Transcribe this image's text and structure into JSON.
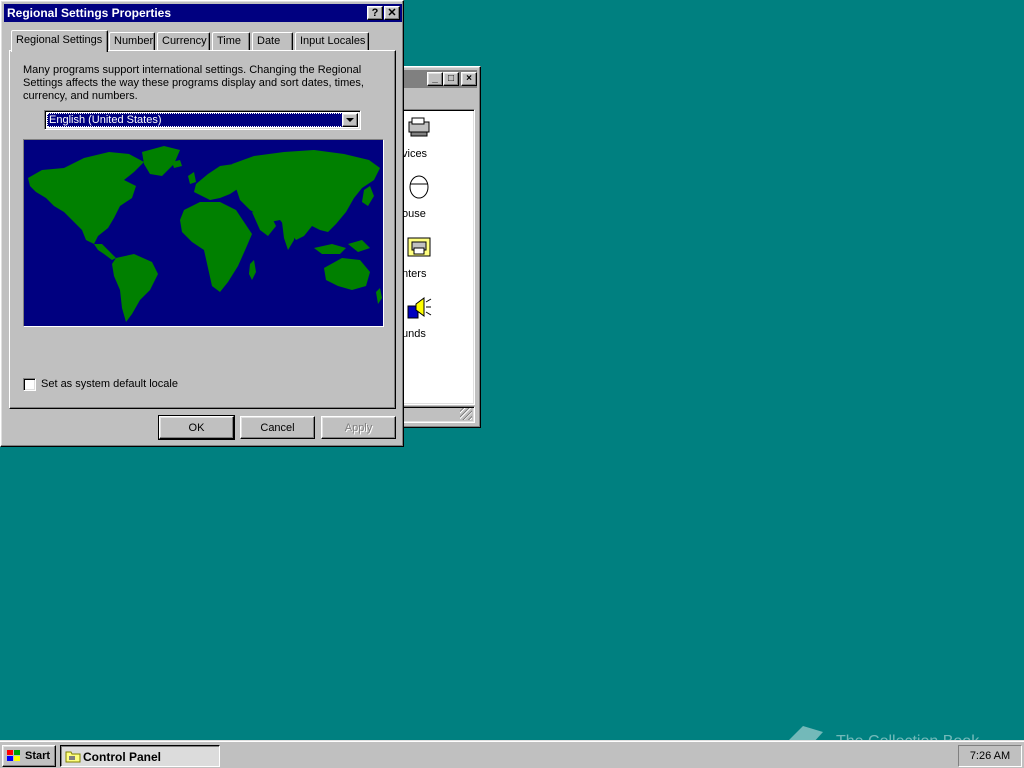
{
  "control_panel": {
    "items": [
      {
        "label": "vices",
        "icon": "devices-icon"
      },
      {
        "label": "ouse",
        "icon": "mouse-icon"
      },
      {
        "label": "nters",
        "icon": "printers-icon"
      },
      {
        "label": "unds",
        "icon": "sounds-icon"
      }
    ]
  },
  "dialog": {
    "title": "Regional Settings Properties",
    "tabs": [
      "Regional Settings",
      "Number",
      "Currency",
      "Time",
      "Date",
      "Input Locales"
    ],
    "active_tab": "Regional Settings",
    "description": "Many programs support international settings. Changing the Regional Settings affects the way these programs display and sort dates, times, currency, and numbers.",
    "locale": "English (United States)",
    "default_locale_label": "Set as system default locale",
    "default_locale_checked": false,
    "buttons": {
      "ok": "OK",
      "cancel": "Cancel",
      "apply": "Apply"
    },
    "colors": {
      "title_bar": "#000080",
      "map_ocean": "#000080",
      "map_land": "#008000"
    }
  },
  "taskbar": {
    "start_label": "Start",
    "task_label": "Control Panel",
    "clock": "7:26 AM"
  },
  "watermark": "The Collection Book",
  "desktop_color": "#008080"
}
